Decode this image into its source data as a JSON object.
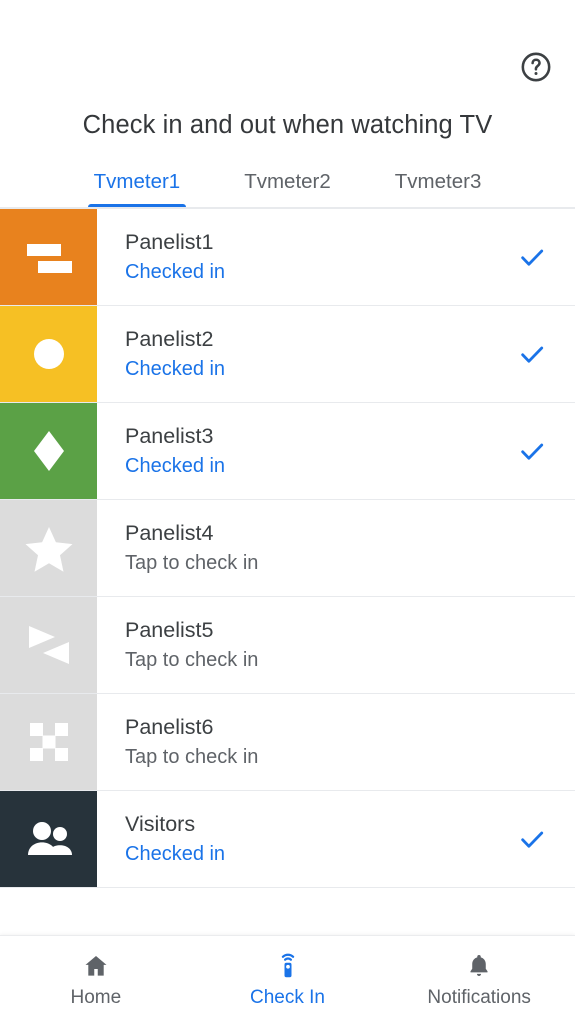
{
  "header": {
    "title": "Check in and out when watching TV",
    "help_icon": "help-circle-icon"
  },
  "tabs": {
    "items": [
      {
        "label": "Tvmeter1",
        "active": true
      },
      {
        "label": "Tvmeter2",
        "active": false
      },
      {
        "label": "Tvmeter3",
        "active": false
      }
    ],
    "active_color": "#1a73e8",
    "inactive_color": "#5f6368"
  },
  "list": {
    "rows": [
      {
        "name": "Panelist1",
        "status": "Checked in",
        "checked": true,
        "swatch_color": "#e8821e",
        "icon": "two-bars-icon"
      },
      {
        "name": "Panelist2",
        "status": "Checked in",
        "checked": true,
        "swatch_color": "#f6c024",
        "icon": "circle-icon"
      },
      {
        "name": "Panelist3",
        "status": "Checked in",
        "checked": true,
        "swatch_color": "#5ba146",
        "icon": "diamond-icon"
      },
      {
        "name": "Panelist4",
        "status": "Tap to check in",
        "checked": false,
        "swatch_color": "#dcdcdc",
        "icon": "star-icon"
      },
      {
        "name": "Panelist5",
        "status": "Tap to check in",
        "checked": false,
        "swatch_color": "#dcdcdc",
        "icon": "two-triangles-icon"
      },
      {
        "name": "Panelist6",
        "status": "Tap to check in",
        "checked": false,
        "swatch_color": "#dcdcdc",
        "icon": "checkerboard-icon"
      },
      {
        "name": "Visitors",
        "status": "Checked in",
        "checked": true,
        "swatch_color": "#27333b",
        "icon": "people-icon"
      }
    ],
    "check_color": "#1a73e8"
  },
  "bottom_nav": {
    "items": [
      {
        "label": "Home",
        "icon": "home-icon",
        "active": false
      },
      {
        "label": "Check In",
        "icon": "remote-control-icon",
        "active": true
      },
      {
        "label": "Notifications",
        "icon": "bell-icon",
        "active": false
      }
    ],
    "active_color": "#1a73e8",
    "inactive_color": "#5f6368"
  }
}
